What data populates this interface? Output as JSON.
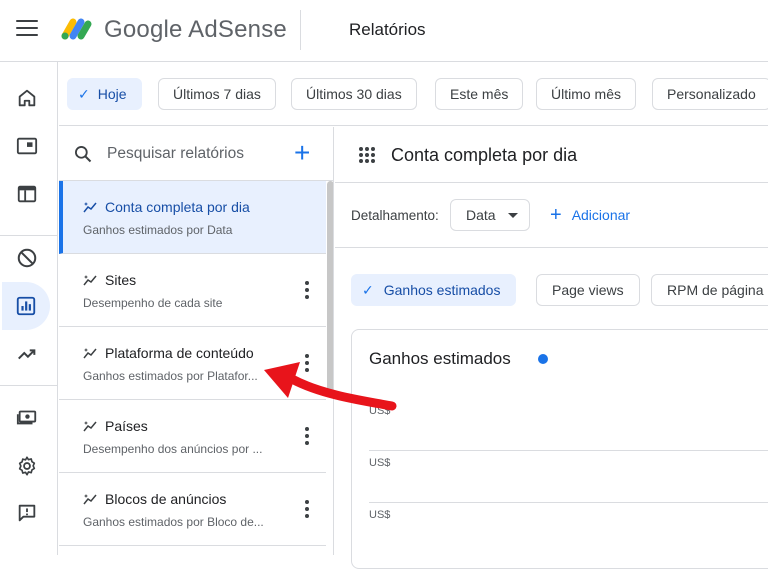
{
  "app": {
    "brand_google": "Google",
    "brand_product": "AdSense",
    "page_title": "Relatórios"
  },
  "rail": {
    "items": [
      "home-icon",
      "ad-unit-icon",
      "browser-icon",
      "block-icon",
      "reports-icon",
      "trending-icon",
      "payments-icon",
      "settings-icon",
      "feedback-icon"
    ],
    "active": "reports-icon"
  },
  "date_chips": [
    {
      "label": "Hoje",
      "selected": true
    },
    {
      "label": "Últimos 7 dias",
      "selected": false
    },
    {
      "label": "Últimos 30 dias",
      "selected": false
    },
    {
      "label": "Este mês",
      "selected": false
    },
    {
      "label": "Último mês",
      "selected": false
    },
    {
      "label": "Personalizado",
      "selected": false
    }
  ],
  "search": {
    "placeholder": "Pesquisar relatórios"
  },
  "reports": [
    {
      "title": "Conta completa por dia",
      "subtitle": "Ganhos estimados por Data",
      "active": true
    },
    {
      "title": "Sites",
      "subtitle": "Desempenho de cada site",
      "active": false
    },
    {
      "title": "Plataforma de conteúdo",
      "subtitle": "Ganhos estimados por Platafor...",
      "active": false
    },
    {
      "title": "Países",
      "subtitle": "Desempenho dos anúncios por ...",
      "active": false
    },
    {
      "title": "Blocos de anúncios",
      "subtitle": "Ganhos estimados por Bloco de...",
      "active": false
    }
  ],
  "main": {
    "title": "Conta completa por dia",
    "breakdown_label": "Detalhamento:",
    "breakdown_value": "Data",
    "add_label": "Adicionar"
  },
  "metric_chips": [
    {
      "label": "Ganhos estimados",
      "selected": true
    },
    {
      "label": "Page views",
      "selected": false
    },
    {
      "label": "RPM de página",
      "selected": false
    }
  ],
  "chart": {
    "title": "Ganhos estimados",
    "series_color": "#1a73e8",
    "axis_labels": [
      "US$",
      "US$",
      "US$"
    ]
  },
  "colors": {
    "accent": "#1a73e8",
    "selected_bg": "#e8f0fe",
    "annotation_arrow": "#e8141b"
  }
}
